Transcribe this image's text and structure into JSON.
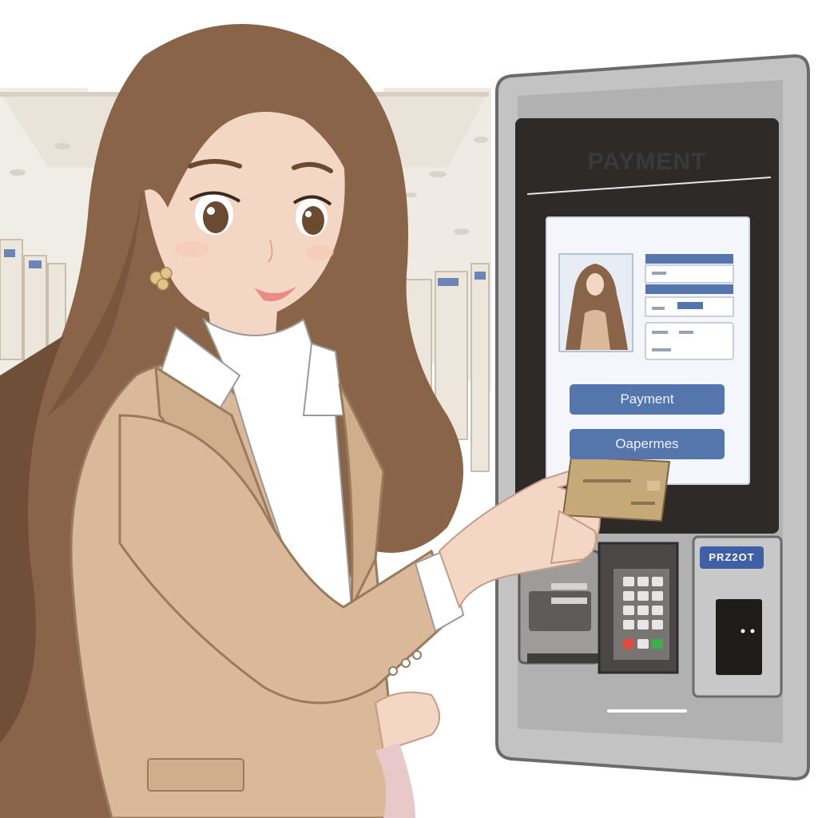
{
  "kiosk": {
    "screen_title": "PAYMENT",
    "buttons": [
      {
        "label": "Payment"
      },
      {
        "label": "Oapermes"
      }
    ],
    "reader_label": "PRZ2OT"
  },
  "colors": {
    "hair": "#8a6448",
    "blazer": "#d9b99a",
    "shirt": "#ffffff",
    "kiosk_body": "#bdbcbc",
    "screen_bezel": "#2e2a28",
    "screen": "#f4f6fb",
    "button": "#5575ad",
    "card": "#c6a978"
  }
}
